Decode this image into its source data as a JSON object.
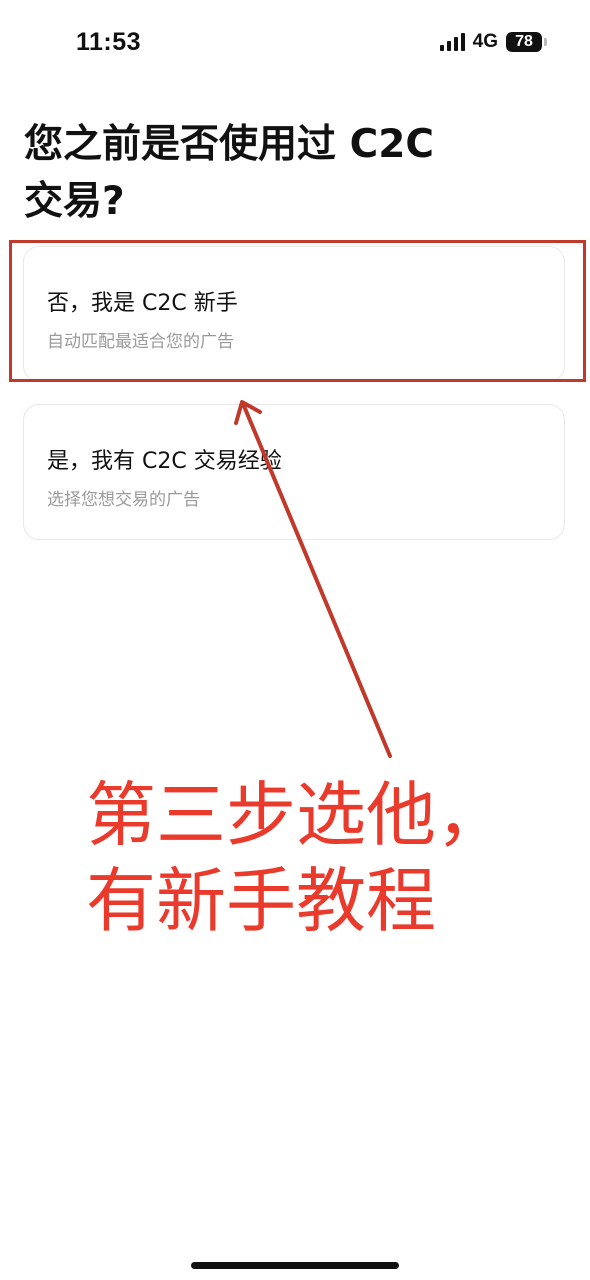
{
  "status_bar": {
    "time": "11:53",
    "network": "4G",
    "battery": "78"
  },
  "page": {
    "title_line1": "您之前是否使用过 C2C",
    "title_line2": "交易?"
  },
  "options": [
    {
      "title": "否，我是 C2C 新手",
      "subtitle": "自动匹配最适合您的广告"
    },
    {
      "title": "是，我有 C2C 交易经验",
      "subtitle": "选择您想交易的广告"
    }
  ],
  "annotation": {
    "line1": "第三步选他，",
    "line2": "有新手教程",
    "color": "#ea3a2c"
  },
  "icons": {
    "signal": "cellular-signal-icon",
    "battery": "battery-icon"
  }
}
